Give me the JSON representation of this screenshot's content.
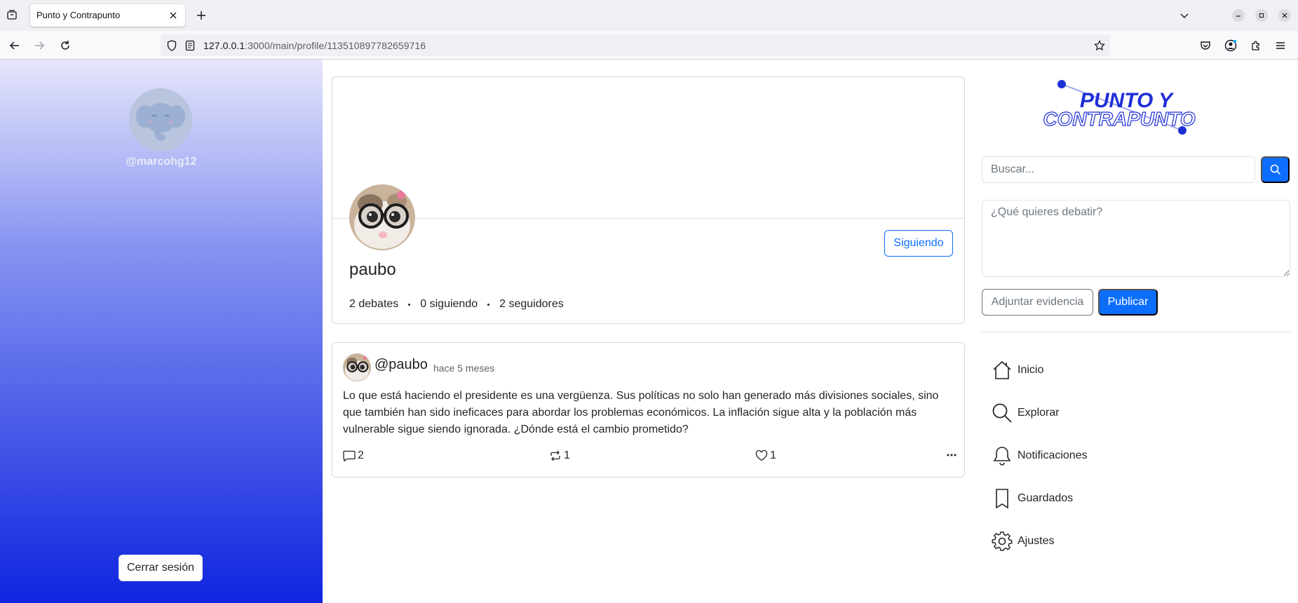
{
  "browser": {
    "tab_title": "Punto y Contrapunto",
    "url_host": "127.0.0.1",
    "url_rest": ":3000/main/profile/113510897782659716"
  },
  "sidebar": {
    "handle": "@marcohg12",
    "logout_label": "Cerrar sesión"
  },
  "profile": {
    "name": "paubo",
    "follow_label": "Siguiendo",
    "stats": {
      "debates": "2 debates",
      "following": "0 siguiendo",
      "followers": "2 seguidores"
    }
  },
  "post": {
    "user": "@paubo",
    "time": "hace 5 meses",
    "text": "Lo que está haciendo el presidente es una vergüenza. Sus políticas no solo han generado más divisiones sociales, sino que también han sido ineficaces para abordar los problemas económicos. La inflación sigue alta y la población más vulnerable sigue siendo ignorada. ¿Dónde está el cambio prometido?",
    "comments": "2",
    "reposts": "1",
    "likes": "1"
  },
  "right": {
    "logo_line1": "PUNTO Y",
    "logo_line2": "CONTRAPUNTO",
    "search_placeholder": "Buscar...",
    "debate_placeholder": "¿Qué quieres debatir?",
    "attach_label": "Adjuntar evidencia",
    "publish_label": "Publicar",
    "menu": [
      {
        "label": "Inicio",
        "icon": "house-icon"
      },
      {
        "label": "Explorar",
        "icon": "search-icon"
      },
      {
        "label": "Notificaciones",
        "icon": "bell-icon"
      },
      {
        "label": "Guardados",
        "icon": "bookmark-icon"
      },
      {
        "label": "Ajustes",
        "icon": "gear-icon"
      }
    ]
  },
  "colors": {
    "primary": "#0d6efd",
    "sidebar_top": "#e6e6fb",
    "sidebar_bottom": "#0f24e0",
    "logo_blue": "#1f2fd6"
  }
}
